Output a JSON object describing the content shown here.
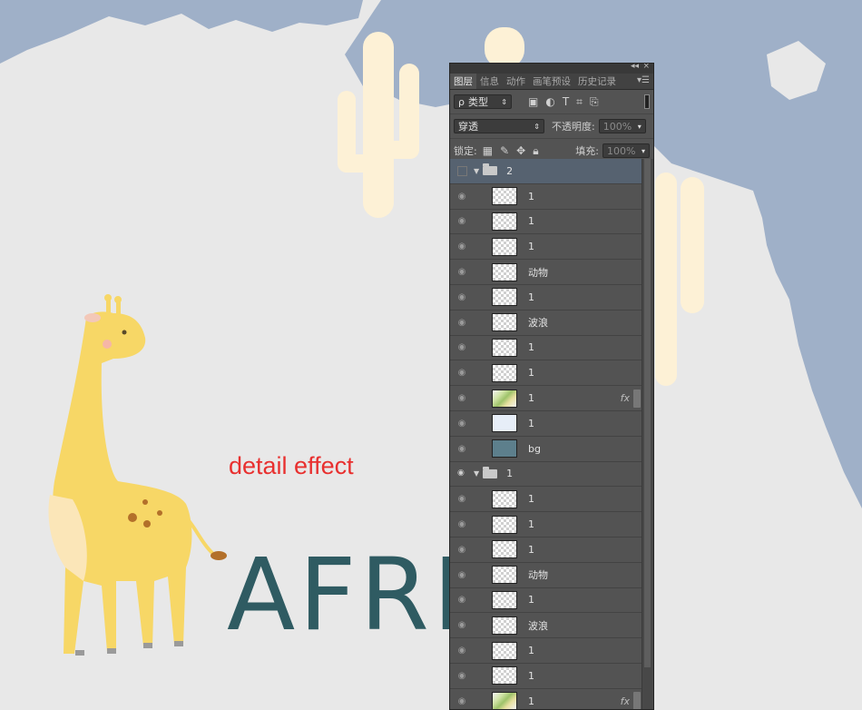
{
  "caption": "detail effect",
  "canvas_text": "AFRI",
  "panel": {
    "window_controls": {
      "collapse": "◂◂",
      "close": "×"
    },
    "tabs": [
      "图层",
      "信息",
      "动作",
      "画笔预设",
      "历史记录"
    ],
    "active_tab": "图层",
    "filter": {
      "label": "类型",
      "prefix": "ρ"
    },
    "blend_mode": "穿透",
    "opacity_label": "不透明度:",
    "opacity_value": "100%",
    "lock_label": "锁定:",
    "fill_label": "填充:",
    "fill_value": "100%",
    "layers": [
      {
        "type": "group",
        "name": "2",
        "selected": true
      },
      {
        "type": "layer",
        "name": "1",
        "thumb": "transparent"
      },
      {
        "type": "layer",
        "name": "1",
        "thumb": "transparent"
      },
      {
        "type": "layer",
        "name": "1",
        "thumb": "transparent"
      },
      {
        "type": "layer",
        "name": "动物",
        "thumb": "transparent"
      },
      {
        "type": "layer",
        "name": "1",
        "thumb": "transparent"
      },
      {
        "type": "layer",
        "name": "波浪",
        "thumb": "transparent"
      },
      {
        "type": "layer",
        "name": "1",
        "thumb": "transparent"
      },
      {
        "type": "layer",
        "name": "1",
        "thumb": "transparent"
      },
      {
        "type": "layer",
        "name": "1",
        "thumb": "green",
        "fx": "fx"
      },
      {
        "type": "layer",
        "name": "1",
        "thumb": "light"
      },
      {
        "type": "layer",
        "name": "bg",
        "thumb": "bg"
      },
      {
        "type": "group",
        "name": "1",
        "selected": false
      },
      {
        "type": "layer",
        "name": "1",
        "thumb": "transparent"
      },
      {
        "type": "layer",
        "name": "1",
        "thumb": "transparent"
      },
      {
        "type": "layer",
        "name": "1",
        "thumb": "transparent"
      },
      {
        "type": "layer",
        "name": "动物",
        "thumb": "transparent"
      },
      {
        "type": "layer",
        "name": "1",
        "thumb": "transparent"
      },
      {
        "type": "layer",
        "name": "波浪",
        "thumb": "transparent"
      },
      {
        "type": "layer",
        "name": "1",
        "thumb": "transparent"
      },
      {
        "type": "layer",
        "name": "1",
        "thumb": "transparent"
      },
      {
        "type": "layer",
        "name": "1",
        "thumb": "green",
        "fx": "fx"
      },
      {
        "type": "layer",
        "name": "",
        "thumb": "transparent"
      }
    ]
  },
  "colors": {
    "map_blue": "#9fb0c8",
    "cactus": "#fdf1d6",
    "giraffe": "#f7d766",
    "text_teal": "#2f5b62",
    "caption_red": "#e8302f"
  }
}
